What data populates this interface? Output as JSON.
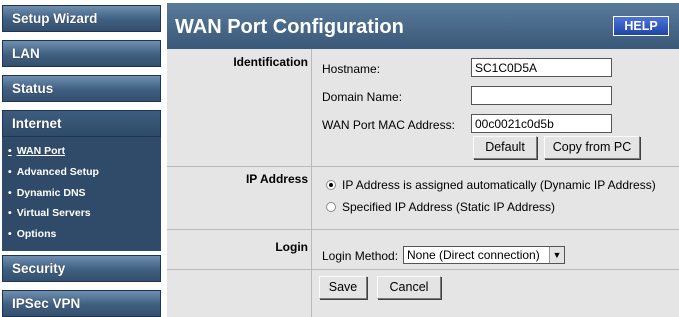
{
  "sidebar": {
    "items": [
      {
        "label": "Setup Wizard"
      },
      {
        "label": "LAN"
      },
      {
        "label": "Status"
      },
      {
        "label": "Internet"
      },
      {
        "label": "Security"
      },
      {
        "label": "IPSec VPN"
      }
    ],
    "internet_submenu": [
      {
        "label": "WAN Port"
      },
      {
        "label": "Advanced Setup"
      },
      {
        "label": "Dynamic DNS"
      },
      {
        "label": "Virtual Servers"
      },
      {
        "label": "Options"
      }
    ],
    "bullet": "•"
  },
  "header": {
    "title": "WAN Port Configuration",
    "help_label": "HELP"
  },
  "identification": {
    "section_label": "Identification",
    "hostname_label": "Hostname:",
    "hostname_value": "SC1C0D5A",
    "domain_label": "Domain Name:",
    "domain_value": "",
    "mac_label": "WAN Port MAC Address:",
    "mac_value": "00c0021c0d5b",
    "default_button": "Default",
    "copy_button": "Copy from PC"
  },
  "ip_address": {
    "section_label": "IP Address",
    "options": [
      {
        "label": "IP Address is assigned automatically (Dynamic IP Address)",
        "checked": true
      },
      {
        "label": "Specified IP Address (Static IP Address)",
        "checked": false
      }
    ]
  },
  "login": {
    "section_label": "Login",
    "method_label": "Login Method:",
    "method_value": "None (Direct connection)"
  },
  "footer": {
    "save_label": "Save",
    "cancel_label": "Cancel"
  },
  "colors": {
    "nav_blue": "#3f5f80",
    "help_blue": "#1f44a8",
    "panel_gray": "#e5e5e5"
  }
}
